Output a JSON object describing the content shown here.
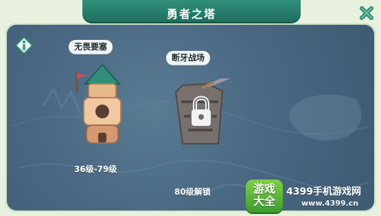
{
  "header": {
    "title": "勇者之塔"
  },
  "stages": [
    {
      "name": "无畏要塞",
      "level_range": "36级-79级"
    },
    {
      "name": "断牙战场",
      "lock_text": "80级解锁"
    }
  ],
  "watermark": {
    "badge": "游戏\n大全",
    "brand": "4399手机游戏网",
    "url": "www.4399.cn"
  },
  "colors": {
    "header": "#2f8f7a",
    "map": "#4a6882",
    "accent": "#6ccf3a"
  },
  "icons": {
    "close": "close-icon",
    "info": "info-icon",
    "lock": "lock-icon"
  }
}
